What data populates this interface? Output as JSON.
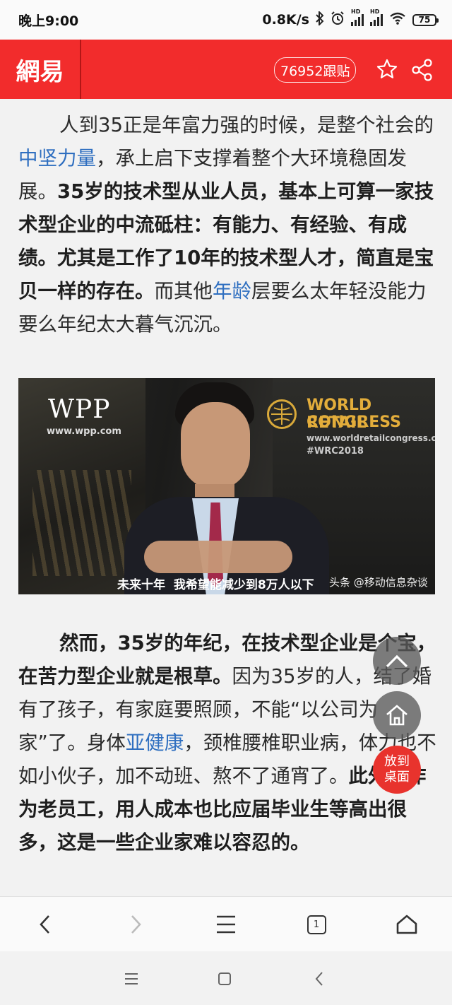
{
  "status_bar": {
    "time": "晚上9:00",
    "network_speed": "0.8K/s",
    "signal_badge_1": "HD",
    "signal_badge_2": "HD",
    "battery": "75"
  },
  "header": {
    "logo_text": "網易",
    "comment_count": "76952跟贴",
    "brand_color": "#f22c2c"
  },
  "article": {
    "para1": {
      "t1": "人到35正是年富力强的时候，是整个社会的",
      "link1": "中坚力量",
      "t2": "，承上启下支撑着整个大环境稳固发展。",
      "b1": "35岁的技术型从业人员，基本上可算一家技术型企业的中流砥柱：有能力、有经验、有成绩。尤其是工作了10年的技术型人才，简直是宝贝一样的存在。",
      "t3": "而其他",
      "link2": "年龄",
      "t4": "层要么太年轻没能力要么年纪太大暮气沉沉。"
    },
    "image": {
      "logo_left": "WPP",
      "logo_left_url": "www.wpp.com",
      "congress_line1": "WORLD RETAIL",
      "congress_line2": "CONGRESS",
      "congress_url": "www.worldretailcongress.com",
      "hashtag": "#WRC2018",
      "subtitle": "未来十年  我希望能减少到8万人以下",
      "watermark": "头条 @移动信息杂谈"
    },
    "para2": {
      "b1": "然而，35岁的年纪，在技术型企业是个宝，在苦力型企业就是根草。",
      "t1": "因为35岁的人，结了婚有了孩子，有家庭要照顾，不能“以公司为家”了。身体",
      "link1": "亚健康",
      "t2": "，颈椎腰椎职业病，体力也不如小伙子，加不动班、熬不了通宵了。",
      "b2": "此外，作为老员工，用人成本也比应届毕业生等高出很多，这是一些企业家难以容忍的。"
    }
  },
  "floating": {
    "add_to_desktop_line1": "放到",
    "add_to_desktop_line2": "桌面"
  },
  "browser_bar": {
    "tab_count": "1"
  }
}
